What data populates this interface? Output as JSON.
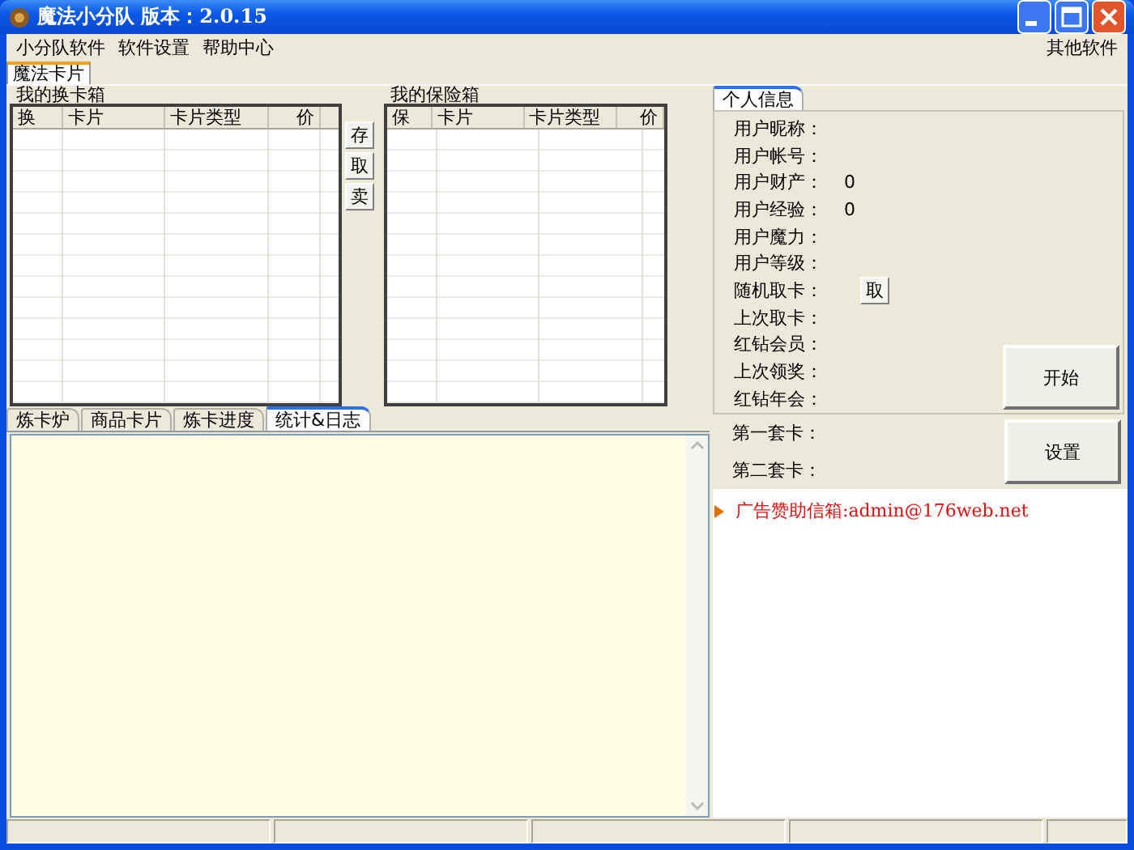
{
  "window": {
    "title": "魔法小分队  版本：2.0.15"
  },
  "menu": [
    "小分队软件",
    "软件设置",
    "帮助中心"
  ],
  "menu_right": "其他软件",
  "top_tabs": [
    {
      "label": "魔法卡片",
      "selected": true
    }
  ],
  "exchange_box": {
    "title": "我的换卡箱",
    "columns": [
      "换",
      "卡片",
      "卡片类型",
      "价"
    ]
  },
  "side_buttons": [
    "存",
    "取",
    "卖"
  ],
  "safe_box": {
    "title": "我的保险箱",
    "columns": [
      "保",
      "卡片",
      "卡片类型",
      "价"
    ]
  },
  "info_tabs": [
    {
      "label": "个人信息",
      "selected": true
    }
  ],
  "info_fields": [
    {
      "kind": "text",
      "label": "用户昵称："
    },
    {
      "kind": "text",
      "label": "用户帐号："
    },
    {
      "kind": "text",
      "label": "用户财产：",
      "value": "0"
    },
    {
      "kind": "text",
      "label": "用户经验：",
      "value": "0"
    },
    {
      "kind": "text",
      "label": "用户魔力："
    },
    {
      "kind": "text",
      "label": "用户等级："
    },
    {
      "kind": "button",
      "label": "随机取卡：",
      "button": "取"
    },
    {
      "kind": "text",
      "label": "上次取卡："
    },
    {
      "kind": "text",
      "label": "红钻会员："
    },
    {
      "kind": "text",
      "label": "上次领奖："
    },
    {
      "kind": "text",
      "label": "红钻年会："
    }
  ],
  "start_button": "开始",
  "set_fields": [
    "第一套卡：",
    "第二套卡："
  ],
  "settings_button": "设置",
  "ad_lines": [
    "广告赞助信箱:admin@176web.net"
  ],
  "bottom_tabs": [
    {
      "label": "炼卡炉",
      "selected": false
    },
    {
      "label": "商品卡片",
      "selected": false
    },
    {
      "label": "炼卡进度",
      "selected": false
    },
    {
      "label": "统计&日志",
      "selected": true
    }
  ]
}
